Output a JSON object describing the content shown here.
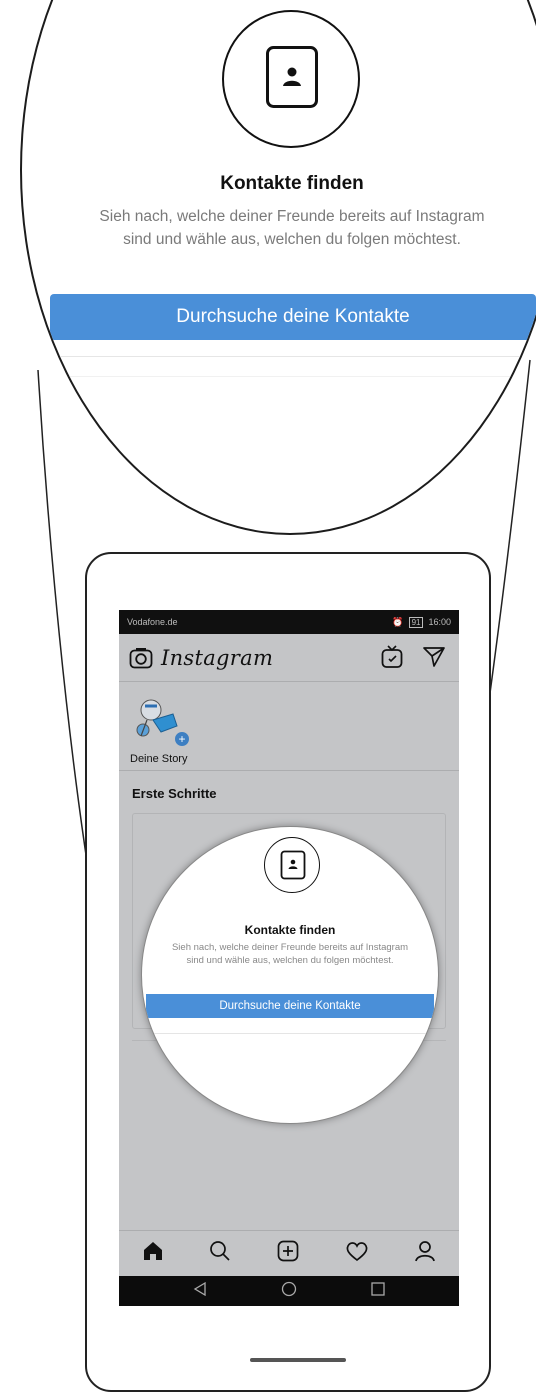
{
  "magnified": {
    "title": "Kontakte finden",
    "description_line1": "Sieh nach, welche deiner Freunde bereits auf Instagram",
    "description_line2": "sind und wähle aus, welchen du folgen möchtest.",
    "button_label": "Durchsuche deine Kontakte",
    "contact_icon": "contact-card-icon"
  },
  "status_bar": {
    "carrier": "Vodafone.de",
    "battery": "91",
    "time": "16:00"
  },
  "app_bar": {
    "title": "Instagram",
    "camera_icon": "camera-icon",
    "igtv_icon": "igtv-icon",
    "direct_icon": "direct-message-icon"
  },
  "stories": {
    "own_story_label": "Deine Story"
  },
  "section": {
    "title": "Erste Schritte"
  },
  "card": {
    "title": "Kontakte finden",
    "description_line1": "Sieh nach, welche deiner Freunde bereits auf Instagram",
    "description_line2": "sind und wähle aus, welchen du folgen möchtest.",
    "button_label": "Durchsuche deine Kontakte"
  },
  "bottom_nav": {
    "items": [
      "home-icon",
      "search-icon",
      "add-post-icon",
      "activity-heart-icon",
      "profile-icon"
    ]
  },
  "system_nav": {
    "items": [
      "back-icon",
      "home-circle-icon",
      "recents-icon"
    ]
  },
  "colors": {
    "accent_blue": "#4a8fd8",
    "screen_gray": "#c4c5c7",
    "status_bar": "#101010"
  }
}
